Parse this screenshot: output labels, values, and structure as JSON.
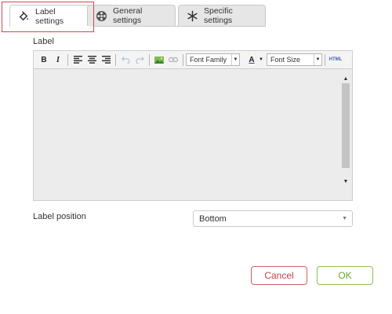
{
  "tabs": [
    {
      "label": "Label settings",
      "icon": "paint-bucket-icon",
      "active": true
    },
    {
      "label": "General settings",
      "icon": "film-reel-icon",
      "active": false
    },
    {
      "label": "Specific settings",
      "icon": "snowflake-icon",
      "active": false
    }
  ],
  "label_section": {
    "label": "Label"
  },
  "toolbar": {
    "bold": "B",
    "italic": "I",
    "font_family": "Font Family",
    "font_color": "A",
    "font_size": "Font Size",
    "html": "HTML"
  },
  "label_position": {
    "label": "Label position",
    "value": "Bottom"
  },
  "buttons": {
    "cancel": "Cancel",
    "ok": "OK"
  },
  "colors": {
    "highlight": "#d9434f",
    "cancel": "#c24040",
    "ok": "#6ea32f"
  }
}
